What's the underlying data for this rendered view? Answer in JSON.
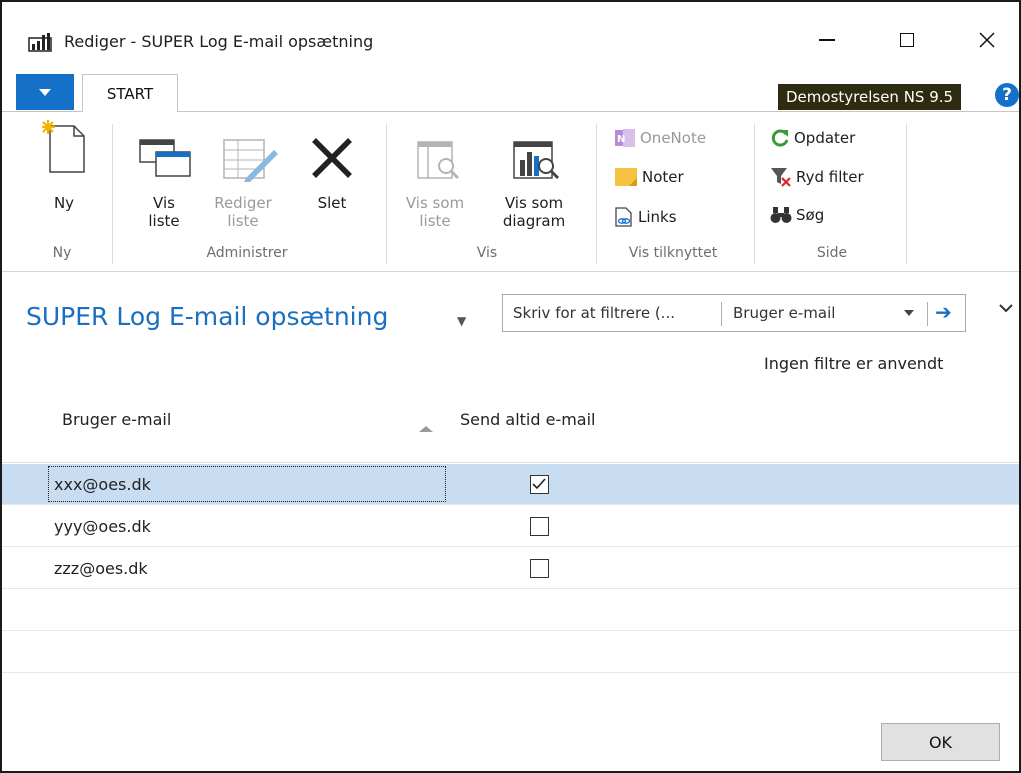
{
  "window": {
    "title": "Rediger - SUPER Log E-mail opsætning"
  },
  "ribbon_tabs": {
    "start": "START",
    "company": "Demostyrelsen NS 9.5",
    "help": "?"
  },
  "ribbon": {
    "ny": {
      "label": "Ny",
      "group": "Ny"
    },
    "administrer": {
      "group": "Administrer",
      "vis_liste_1": "Vis",
      "vis_liste_2": "liste",
      "rediger_liste_1": "Rediger",
      "rediger_liste_2": "liste",
      "slet": "Slet"
    },
    "vis": {
      "group": "Vis",
      "vis_som_liste_1": "Vis som",
      "vis_som_liste_2": "liste",
      "vis_som_diagram_1": "Vis som",
      "vis_som_diagram_2": "diagram"
    },
    "vis_tilknyttet": {
      "group": "Vis tilknyttet",
      "onenote": "OneNote",
      "noter": "Noter",
      "links": "Links"
    },
    "side": {
      "group": "Side",
      "opdater": "Opdater",
      "ryd_filter": "Ryd filter",
      "sog": "Søg"
    }
  },
  "page": {
    "title": "SUPER Log E-mail opsætning",
    "filter_placeholder": "Skriv for at filtrere (...",
    "filter_field": "Bruger e-mail",
    "filter_status": "Ingen filtre er anvendt"
  },
  "grid": {
    "columns": [
      "Bruger e-mail",
      "Send altid e-mail"
    ],
    "rows": [
      {
        "email": "xxx@oes.dk",
        "send_always": true
      },
      {
        "email": "yyy@oes.dk",
        "send_always": false
      },
      {
        "email": "zzz@oes.dk",
        "send_always": false
      }
    ]
  },
  "footer": {
    "ok": "OK"
  },
  "colors": {
    "accent": "#1570c8",
    "title": "#1b6fc2",
    "selected_row": "#c8ddf1",
    "badge": "#2f2b10"
  }
}
